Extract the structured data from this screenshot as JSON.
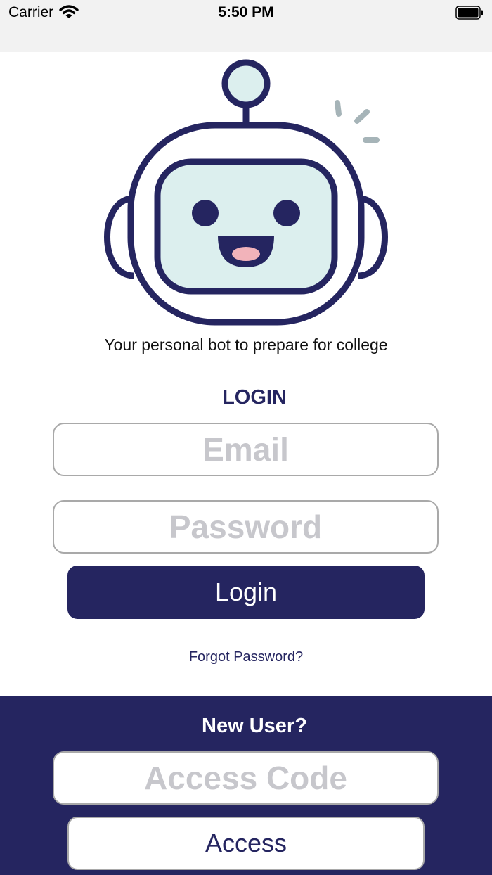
{
  "status_bar": {
    "carrier": "Carrier",
    "time": "5:50 PM",
    "wifi_icon": "wifi-icon",
    "battery_icon": "battery-icon"
  },
  "logo": {
    "icon": "robot-icon",
    "outline_color": "#252560",
    "face_color": "#dcefee",
    "tongue_color": "#f2b3ba"
  },
  "tagline": "Your personal bot to prepare for college",
  "login": {
    "heading": "LOGIN",
    "email_value": "",
    "email_placeholder": "Email",
    "password_value": "",
    "password_placeholder": "Password",
    "button_label": "Login",
    "forgot_label": "Forgot Password?"
  },
  "new_user": {
    "heading": "New User?",
    "access_code_value": "",
    "access_code_placeholder": "Access Code",
    "button_label": "Access"
  },
  "colors": {
    "brand": "#252560",
    "status_bar_bg": "#f2f2f2",
    "placeholder": "#c7c7cc"
  }
}
